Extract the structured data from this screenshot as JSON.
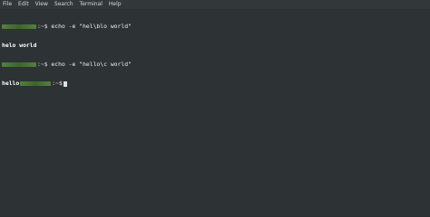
{
  "menu": [
    "File",
    "Edit",
    "View",
    "Search",
    "Terminal",
    "Help"
  ],
  "terminal": {
    "prompt_suffix": ":~$",
    "lines": [
      {
        "command": "echo -e \"hel\\blo world\""
      },
      {
        "output": "helo world"
      },
      {
        "command": "echo -e \"hello\\c world\""
      },
      {
        "output_prefix": "hello"
      }
    ]
  }
}
